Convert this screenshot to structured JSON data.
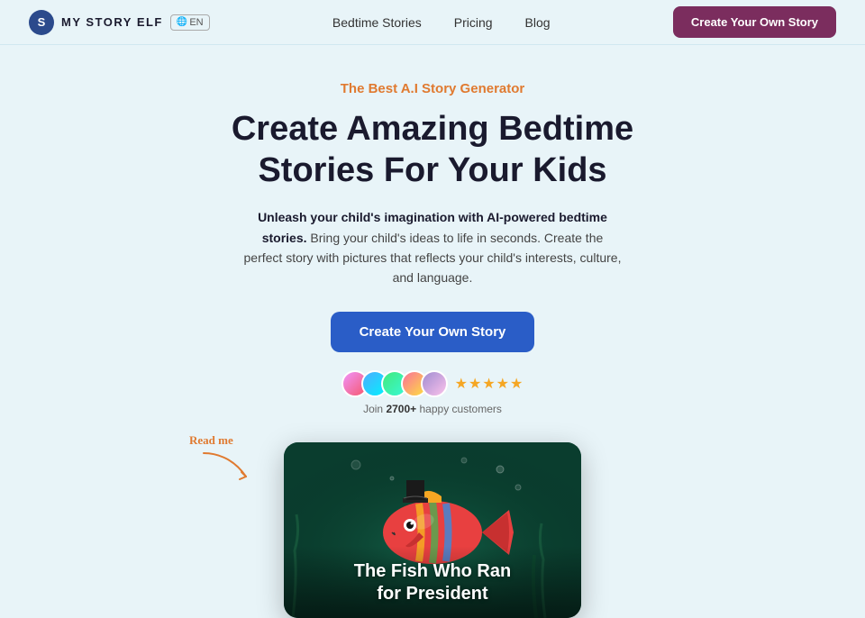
{
  "header": {
    "logo_letter": "S",
    "logo_text": "MY STORY ELF",
    "lang_badge": "EN",
    "nav_items": [
      {
        "label": "Bedtime Stories",
        "href": "#"
      },
      {
        "label": "Pricing",
        "href": "#"
      },
      {
        "label": "Blog",
        "href": "#"
      }
    ],
    "cta_header_label": "Create Your Own Story"
  },
  "hero": {
    "subtitle": "The Best A.I Story Generator",
    "title_line1": "Create Amazing Bedtime",
    "title_line2": "Stories For Your Kids",
    "description_bold": "Unleash your child's imagination with AI-powered bedtime stories.",
    "description_rest": " Bring your child's ideas to life in seconds. Create the perfect story with pictures that reflects your child's interests, culture, and language.",
    "cta_main_label": "Create Your Own Story",
    "social_count_bold": "2700+",
    "social_count_text": "happy customers",
    "social_join": "Join ",
    "stars": "★★★★★"
  },
  "read_me": {
    "label": "Read me"
  },
  "story_card": {
    "title_line1": "The Fish Who Ran",
    "title_line2": "for President"
  }
}
